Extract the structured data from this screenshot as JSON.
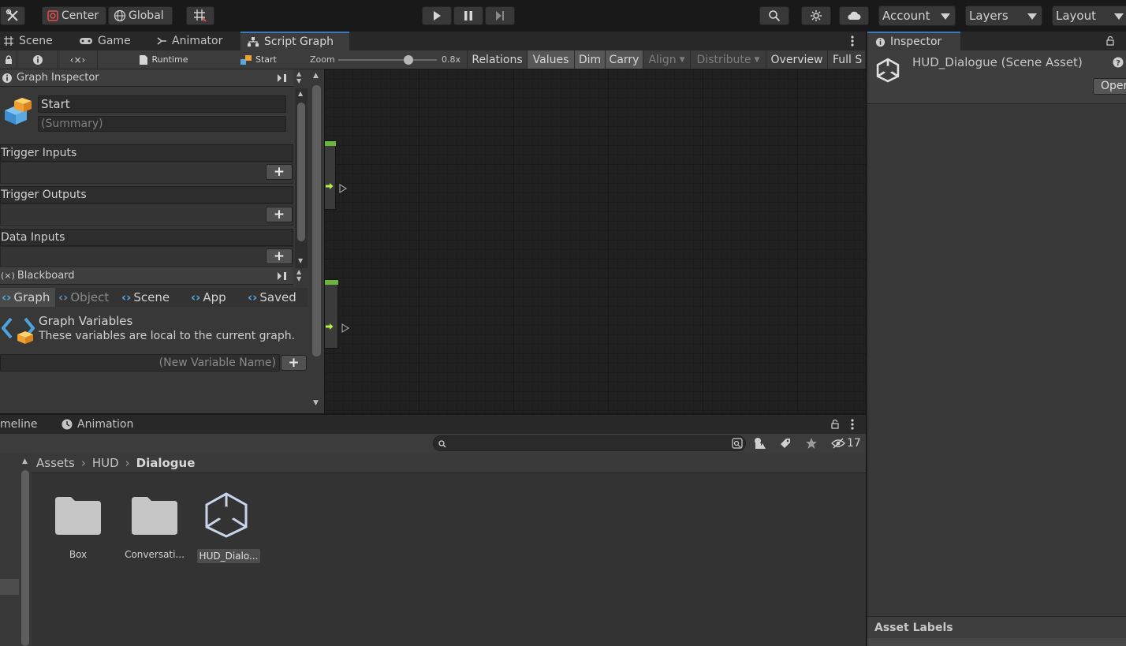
{
  "toolbar": {
    "pivot_center": "Center",
    "pivot_global": "Global",
    "account": "Account",
    "layers": "Layers",
    "layout": "Layout"
  },
  "main_tabs": {
    "scene": "Scene",
    "game": "Game",
    "animator": "Animator",
    "script_graph": "Script Graph"
  },
  "graph_toolbar": {
    "runtime": "Runtime",
    "start": "Start",
    "zoom_label": "Zoom",
    "zoom_value": "0.8x",
    "relations": "Relations",
    "values": "Values",
    "dim": "Dim",
    "carry": "Carry",
    "align": "Align",
    "distribute": "Distribute",
    "overview": "Overview",
    "full_screen": "Full S",
    "zoom_slider_fraction": 0.71
  },
  "graph_inspector": {
    "title": "Graph Inspector",
    "node_title": "Start",
    "summary_placeholder": "(Summary)",
    "sections": [
      "Trigger Inputs",
      "Trigger Outputs",
      "Data Inputs"
    ]
  },
  "blackboard": {
    "title": "Blackboard",
    "tabs": [
      "Graph",
      "Object",
      "Scene",
      "App",
      "Saved"
    ],
    "heading": "Graph Variables",
    "description": "These variables are local to the current graph.",
    "new_variable_placeholder": "(New Variable Name)"
  },
  "bottom_tabs": {
    "timeline": "meline",
    "animation": "Animation"
  },
  "project": {
    "breadcrumb": [
      "Assets",
      "HUD",
      "Dialogue"
    ],
    "hidden_count": "17",
    "assets": [
      {
        "name": "Box",
        "kind": "folder-icon"
      },
      {
        "name": "Conversati...",
        "kind": "folder-icon"
      },
      {
        "name": "HUD_Dialo...",
        "kind": "unity-logo-icon"
      }
    ]
  },
  "inspector": {
    "tab": "Inspector",
    "asset_title": "HUD_Dialogue (Scene Asset)",
    "open_button": "Oper",
    "asset_labels": "Asset Labels"
  },
  "colors": {
    "accent_blue": "#3a79bb",
    "node_green": "#6db53a",
    "flow_arrow": "#b6f04a"
  }
}
